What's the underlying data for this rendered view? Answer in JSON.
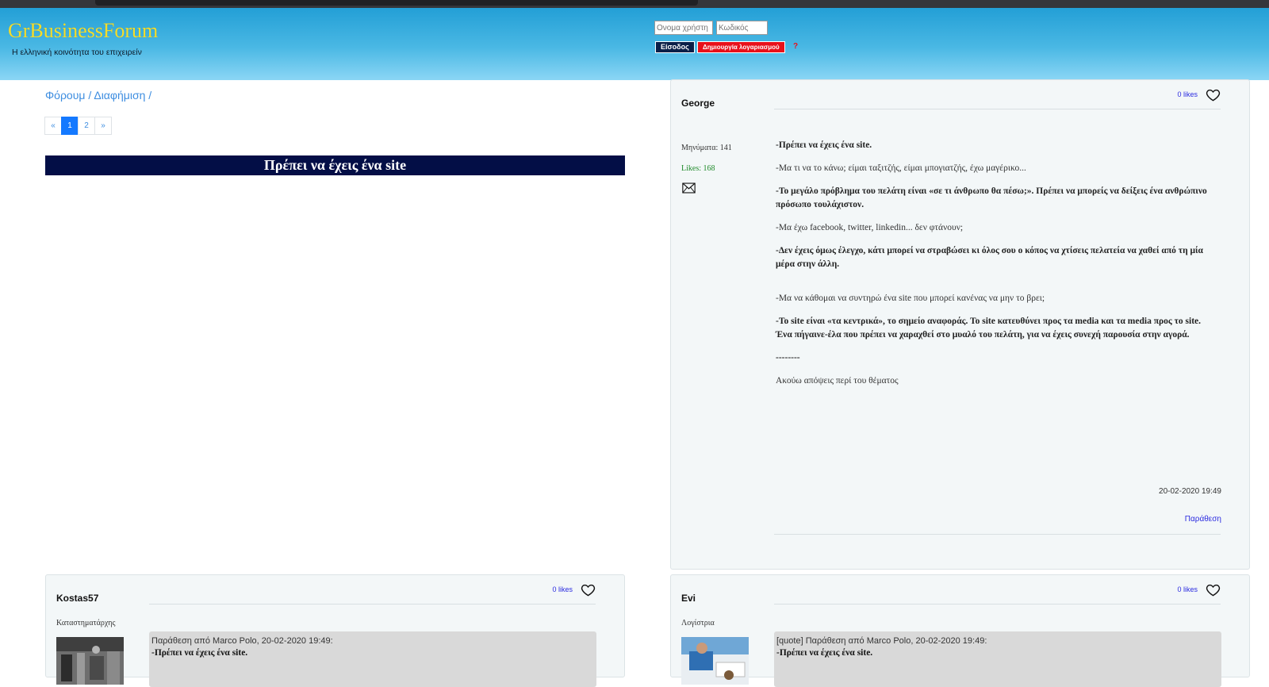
{
  "header": {
    "site_title": "GrBusinessForum",
    "tagline": "Η ελληνική κοινότητα του επιχειρείν",
    "username_placeholder": "Ονομα χρήστη",
    "password_placeholder": "Κωδικός",
    "login_label": "Είσοδος",
    "register_label": "Δημιουργία λογαριασμού",
    "help_label": "?"
  },
  "breadcrumb": [
    "Φόρουμ",
    "/",
    "Διαφήμιση",
    "/"
  ],
  "pagination": {
    "prev": "«",
    "pages": [
      "1",
      "2"
    ],
    "active": "1",
    "next": "»"
  },
  "topic": {
    "title": "Πρέπει να έχεις ένα site"
  },
  "colors": {
    "header_top": "#239fd6",
    "title_bar": "#030e46",
    "title_text": "#f5dd2a",
    "register": "#e8101a",
    "link": "#3d8de0"
  },
  "main_post": {
    "author": "George",
    "likes": "0 likes",
    "messages": "Μηνύματα: 141",
    "user_likes": "Likes: 168",
    "body": [
      "-Πρέπει να έχεις ένα site.",
      "-Μα τι να το κάνω; είμαι ταξιτζής, είμαι μπογιατζής, έχω μαγέρικο...",
      "-Το μεγάλο πρόβλημα του πελάτη είναι «σε τι άνθρωπο θα πέσω;». Πρέπει να μπορείς να δείξεις ένα ανθρώπινο πρόσωπο τουλάχιστον.",
      "-Μα έχω facebook, twitter, linkedin... δεν φτάνουν;",
      "-Δεν έχεις όμως έλεγχο, κάτι μπορεί να στραβώσει κι όλος σου ο κόπος να χτίσεις πελατεία να χαθεί από τη μία μέρα στην άλλη.",
      "-Μα να κάθομαι να συντηρώ ένα site που μπορεί κανένας να μην το βρει;",
      "-Το site είναι «τα κεντρικά», το σημείο αναφοράς. Το site κατευθύνει προς τα media και τα media προς το site. Ένα πήγαινε-έλα που πρέπει να χαραχθεί στο μυαλό του πελάτη, για να έχεις συνεχή παρουσία στην αγορά.",
      "--------",
      "Ακούω απόψεις περί του θέματος"
    ],
    "date": "20-02-2020 19:49",
    "quote_label": "Παράθεση"
  },
  "reply_kostas": {
    "author": "Kostas57",
    "likes": "0 likes",
    "role": "Καταστηματάρχης",
    "quote_head": "Παράθεση από Marco Polo, 20-02-2020 19:49:",
    "quote_text": "-Πρέπει να έχεις ένα site."
  },
  "reply_evi": {
    "author": "Evi",
    "likes": "0 likes",
    "role": "Λογίστρια",
    "quote_head": "[quote] Παράθεση από Marco Polo, 20-02-2020 19:49:",
    "quote_text": "-Πρέπει να έχεις ένα site."
  }
}
